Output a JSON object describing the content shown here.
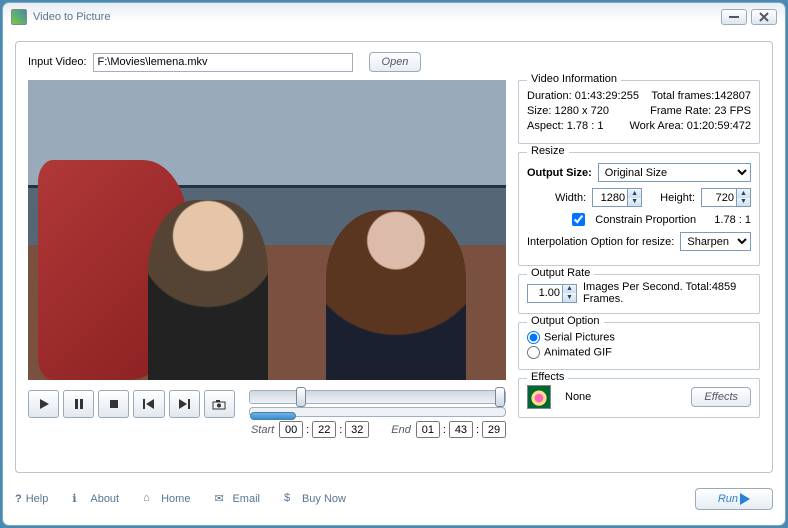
{
  "window": {
    "title": "Video to Picture"
  },
  "input": {
    "label": "Input Video:",
    "value": "F:\\Movies\\lemena.mkv",
    "open": "Open"
  },
  "info": {
    "legend": "Video Information",
    "duration_l": "Duration:",
    "duration_v": "01:43:29:255",
    "frames_l": "Total frames:",
    "frames_v": "142807",
    "size_l": "Size:",
    "size_v": "1280 x 720",
    "fps_l": "Frame Rate:",
    "fps_v": "23 FPS",
    "aspect_l": "Aspect:",
    "aspect_v": "1.78 : 1",
    "work_l": "Work Area:",
    "work_v": "01:20:59:472"
  },
  "resize": {
    "legend": "Resize",
    "outsize_l": "Output Size:",
    "outsize_v": "Original Size",
    "width_l": "Width:",
    "width_v": "1280",
    "height_l": "Height:",
    "height_v": "720",
    "constrain": "Constrain Proportion",
    "ratio": "1.78 : 1",
    "interp_l": "Interpolation Option for resize:",
    "interp_v": "Sharpen"
  },
  "rate": {
    "legend": "Output Rate",
    "value": "1.00",
    "text": "Images Per Second. Total:4859 Frames."
  },
  "option": {
    "legend": "Output Option",
    "serial": "Serial Pictures",
    "gif": "Animated GIF"
  },
  "effects": {
    "legend": "Effects",
    "value": "None",
    "button": "Effects"
  },
  "transport": {
    "start": "Start",
    "end": "End",
    "s_h": "00",
    "s_m": "22",
    "s_s": "32",
    "e_h": "01",
    "e_m": "43",
    "e_s": "29"
  },
  "footer": {
    "help": "Help",
    "about": "About",
    "home": "Home",
    "email": "Email",
    "buy": "Buy Now",
    "run": "Run"
  }
}
